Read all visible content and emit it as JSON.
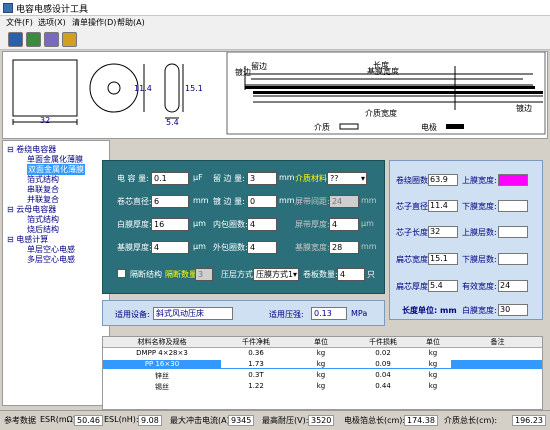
{
  "window": {
    "title": "电容电感设计工具"
  },
  "menu": [
    "文件(F)",
    "选项(X)",
    "清单操作(D)",
    "帮助(A)"
  ],
  "toolbar": {
    "icons": [
      "save-icon",
      "calculator-icon",
      "chart-icon",
      "settings-icon"
    ]
  },
  "diagram": {
    "width_label": "32",
    "height_label_mid": "11.4",
    "height_label_right": "15.1",
    "width_label_right": "5.4",
    "labels_left": [
      "留边",
      "镀边"
    ],
    "label_length": "长度",
    "label_base": "基膜宽度",
    "label_dielectric_width": "介质宽度",
    "label_edge": "镀边",
    "legend": {
      "dielectric": "介质",
      "electrode": "电极"
    }
  },
  "tree": {
    "items": [
      {
        "label": "卷绕电容器",
        "level": 0,
        "icon": "⊟"
      },
      {
        "label": "单面金属化薄膜",
        "level": 1
      },
      {
        "label": "双面金属化薄膜",
        "level": 1,
        "selected": true
      },
      {
        "label": "箔式结构",
        "level": 1
      },
      {
        "label": "串联复合",
        "level": 1
      },
      {
        "label": "并联复合",
        "level": 1
      },
      {
        "label": "云母电容器",
        "level": 0,
        "icon": "⊟"
      },
      {
        "label": "箔式结构",
        "level": 1
      },
      {
        "label": "烧后结构",
        "level": 1
      },
      {
        "label": "电感计算",
        "level": 0,
        "icon": "⊟"
      },
      {
        "label": "单层空心电感",
        "level": 1
      },
      {
        "label": "多层空心电感",
        "level": 1
      }
    ]
  },
  "params": {
    "capacitance": {
      "label": "电 容 量:",
      "value": "0.1",
      "unit": "μF"
    },
    "margin": {
      "label": "留 边 量:",
      "value": "3",
      "unit": "mm"
    },
    "dielectric_label": "介质材料:",
    "dielectric_value": "??",
    "core_dia": {
      "label": "卷芯直径:",
      "value": "6",
      "unit": "mm"
    },
    "edge_amt": {
      "label": "镀 边 量:",
      "value": "0",
      "unit": "mm"
    },
    "offset": {
      "label": "屏带间距:",
      "value": "24",
      "unit": "mm"
    },
    "white_thick": {
      "label": "白膜厚度:",
      "value": "16",
      "unit": "μm"
    },
    "inner_turns": {
      "label": "内包圈数:",
      "value": "4"
    },
    "screen_thick": {
      "label": "屏带厚度:",
      "value": "4",
      "unit": "μm"
    },
    "base_thick": {
      "label": "基膜厚度:",
      "value": "4",
      "unit": "μm"
    },
    "outer_turns": {
      "label": "外包圈数:",
      "value": "4"
    },
    "base_width": {
      "label": "基膜宽度:",
      "value": "28",
      "unit": "mm"
    },
    "split_check": "隔断结构",
    "split_count_label": "隔断数量:",
    "split_count": "3",
    "press_label": "压层方式:",
    "press_value": "压膜方式1",
    "layer_count_label": "卷板数量:",
    "layer_count": "4",
    "layer_unit": "只"
  },
  "results": {
    "turns": {
      "label": "卷绕圈数:",
      "value": "63.9"
    },
    "top_width": {
      "label": "上膜宽度:"
    },
    "core_dia": {
      "label": "芯子直径:",
      "value": "11.4"
    },
    "bottom_width": {
      "label": "下膜宽度:"
    },
    "core_len": {
      "label": "芯子长度:",
      "value": "32"
    },
    "top_layers": {
      "label": "上膜层数:"
    },
    "flat_width": {
      "label": "扁芯宽度:",
      "value": "15.1"
    },
    "bottom_layers": {
      "label": "下膜层数:"
    },
    "flat_thick": {
      "label": "扁芯厚度:",
      "value": "5.4"
    },
    "eff_width": {
      "label": "有效宽度:",
      "value": "24"
    },
    "unit_label": "长度单位: mm",
    "white_width": {
      "label": "白膜宽度:",
      "value": "30"
    },
    "accent": "#ff00ff"
  },
  "device": {
    "label": "适用设备:",
    "value": "斜式风动压床",
    "pressure_label": "适用压强:",
    "pressure": "0.13",
    "pressure_unit": "MPa"
  },
  "table": {
    "headers": [
      "材料名称及规格",
      "千件净耗",
      "单位",
      "千件损耗",
      "单位",
      "备注"
    ],
    "rows": [
      [
        "DMPP 4×28×3",
        "0.36",
        "kg",
        "0.02",
        "kg",
        ""
      ],
      [
        "PP 16×30",
        "1.73",
        "kg",
        "0.09",
        "kg",
        ""
      ],
      [
        "锌丝",
        "0.3T",
        "kg",
        "0.04",
        "kg",
        ""
      ],
      [
        "锡丝",
        "1.22",
        "kg",
        "0.44",
        "kg",
        ""
      ]
    ]
  },
  "status": {
    "items": [
      {
        "label": "参考数据",
        "value": ""
      },
      {
        "label": "ESR(mΩ)",
        "value": "50.46"
      },
      {
        "label": "ESL(nH):",
        "value": "9.08"
      },
      {
        "label": "最大冲击电流(A):",
        "value": "9345"
      },
      {
        "label": "最高耐压(V):",
        "value": "3520"
      },
      {
        "label": "电极箔总长(cm):",
        "value": "174.38"
      },
      {
        "label": "介质总长(cm):",
        "value": "196.23"
      }
    ]
  }
}
